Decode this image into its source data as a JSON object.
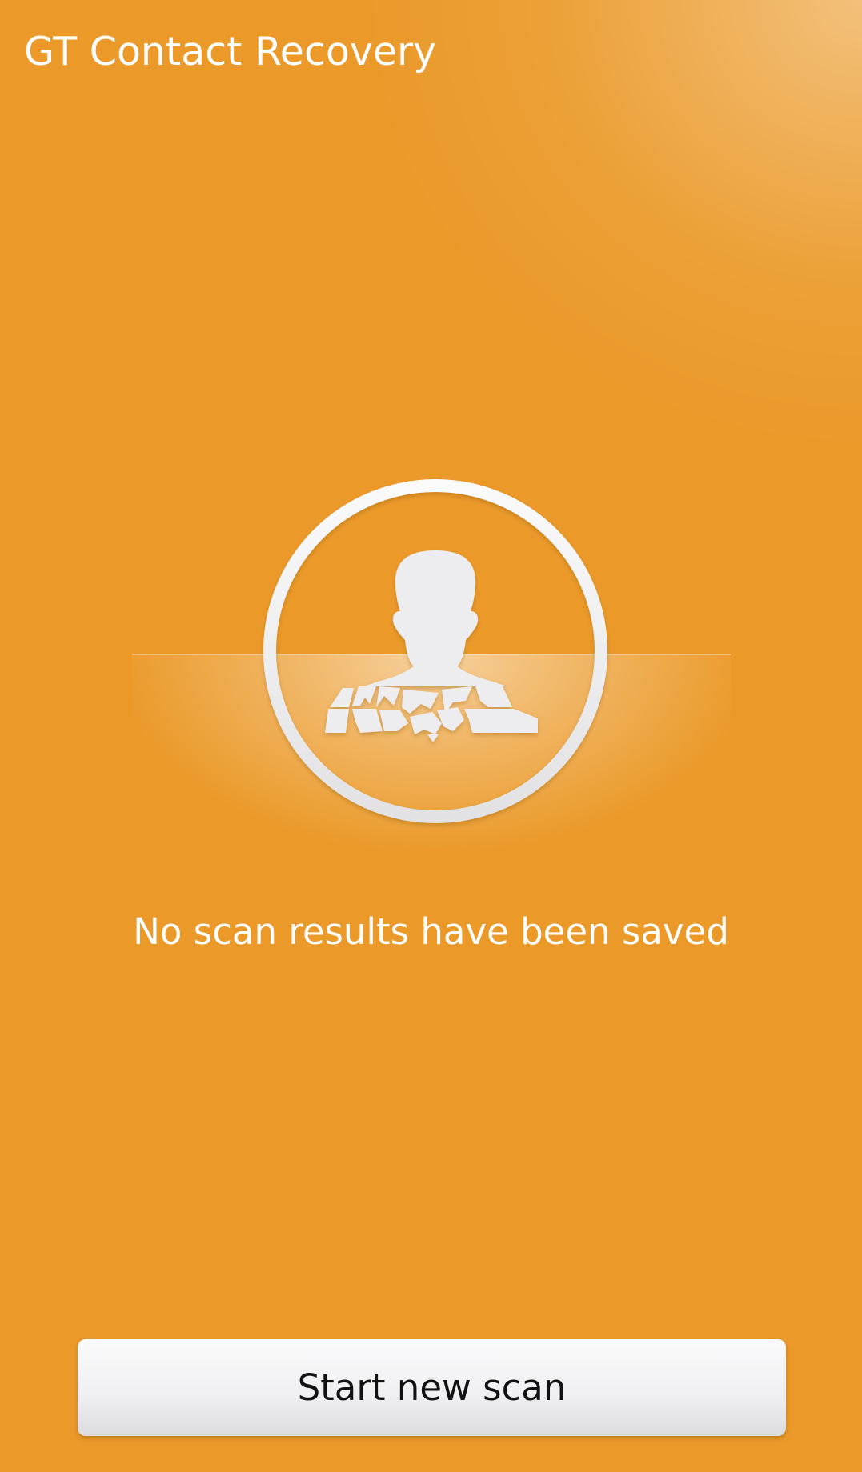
{
  "app": {
    "title": "GT Contact Recovery"
  },
  "empty_state": {
    "icon": "broken-contact-icon",
    "message": "No scan results have been saved"
  },
  "actions": {
    "start_scan_label": "Start new scan"
  },
  "colors": {
    "background": "#EB9A2A",
    "text": "#FFFFFF",
    "button_text": "#111111",
    "icon": "#EDEDEF"
  }
}
